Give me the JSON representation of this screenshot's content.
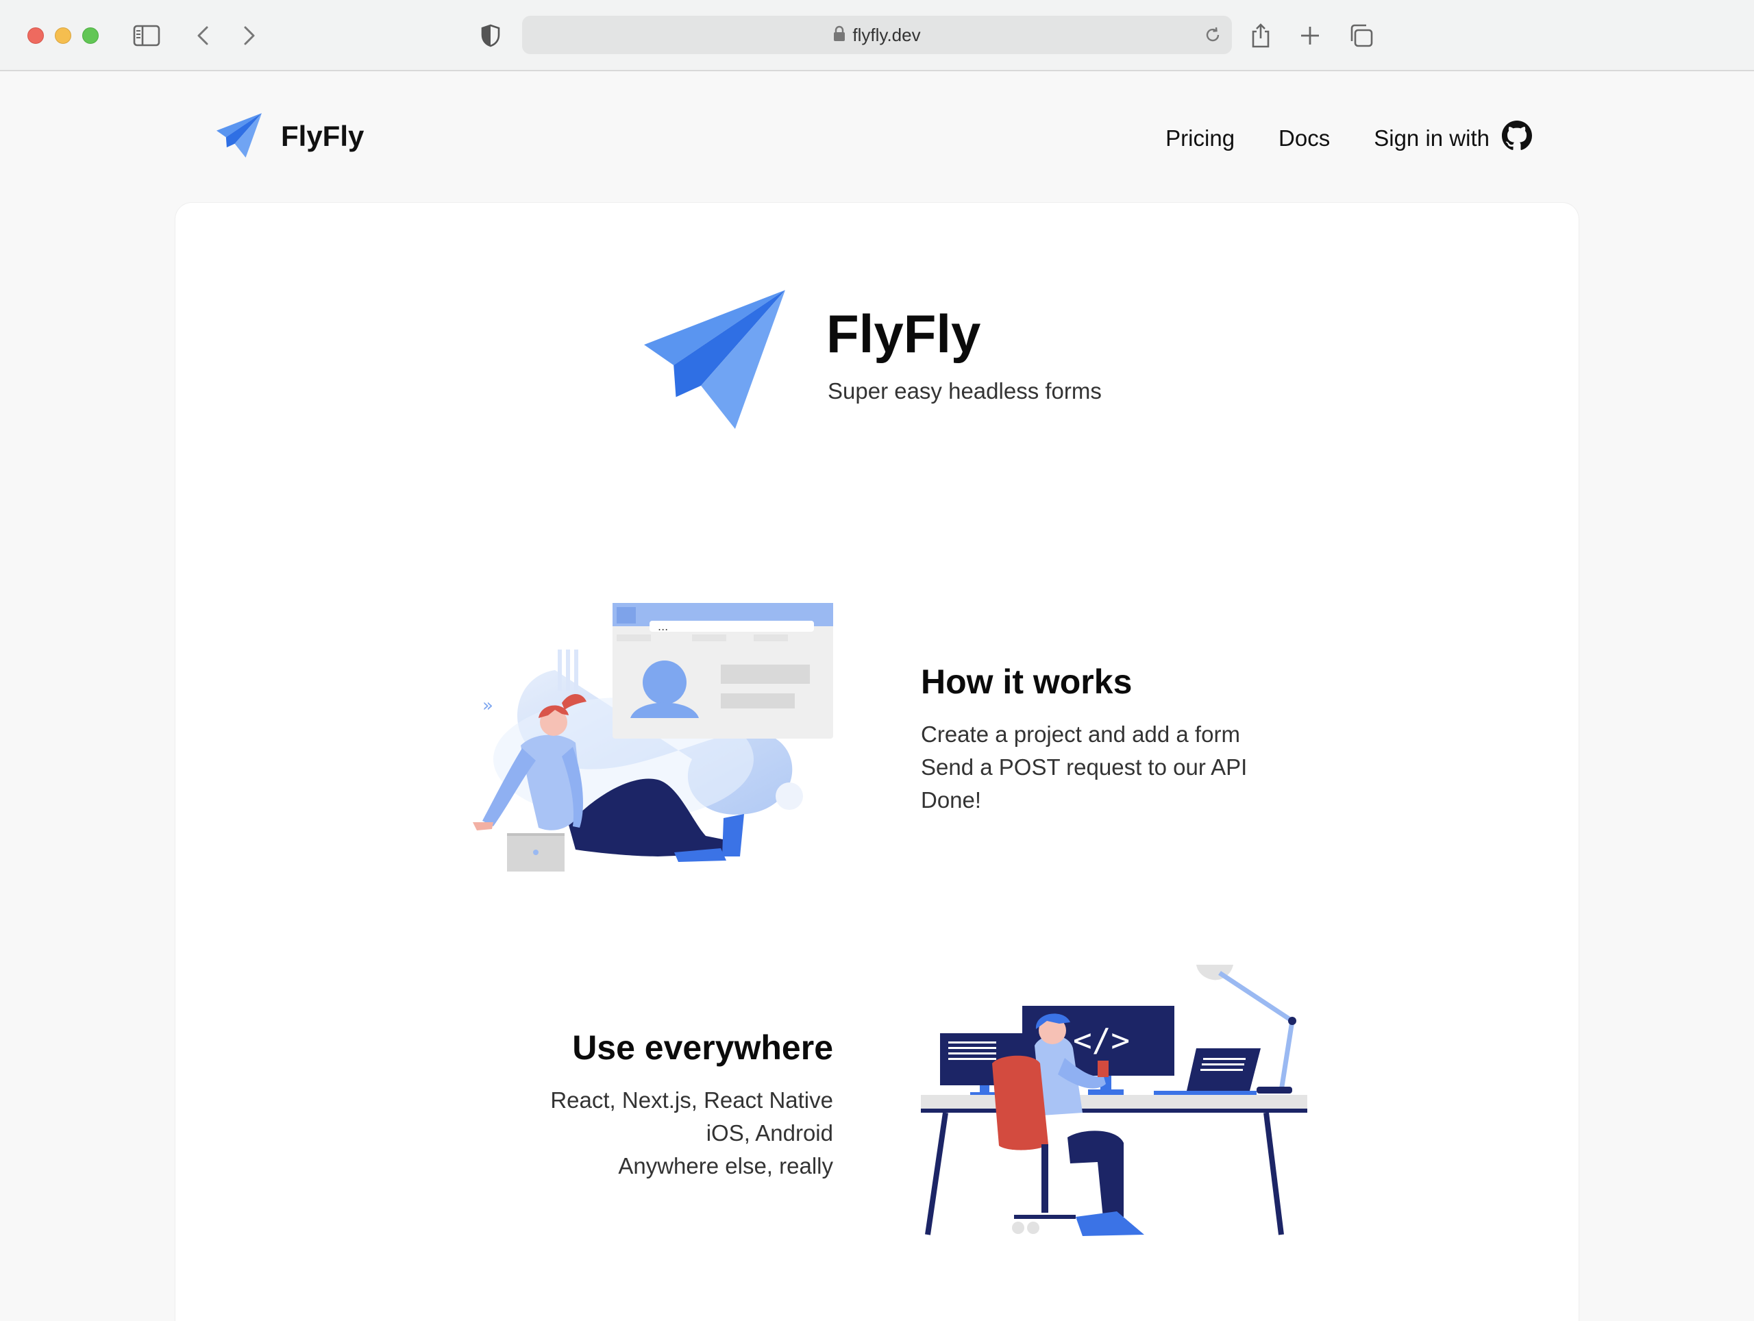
{
  "browser": {
    "url": "flyfly.dev"
  },
  "header": {
    "brand": "FlyFly",
    "nav": [
      {
        "label": "Pricing"
      },
      {
        "label": "Docs"
      },
      {
        "label": "Sign in with"
      }
    ]
  },
  "hero": {
    "title": "FlyFly",
    "subtitle": "Super easy headless forms"
  },
  "how_it_works": {
    "title": "How it works",
    "lines": [
      "Create a project and add a form",
      "Send a POST request to our API",
      "Done!"
    ]
  },
  "use_everywhere": {
    "title": "Use everywhere",
    "lines": [
      "React, Next.js, React Native",
      "iOS, Android",
      "Anywhere else, really"
    ]
  },
  "illustrations": {
    "card_menu_dots": "..."
  },
  "colors": {
    "accent_blue": "#4f8ef3",
    "navy": "#1c2566",
    "chair_red": "#d34b3f"
  },
  "icons": [
    "sidebar-icon",
    "back-icon",
    "forward-icon",
    "shield-icon",
    "lock-icon",
    "reload-icon",
    "share-icon",
    "new-tab-icon",
    "tabs-icon",
    "paper-plane-icon",
    "github-icon"
  ]
}
